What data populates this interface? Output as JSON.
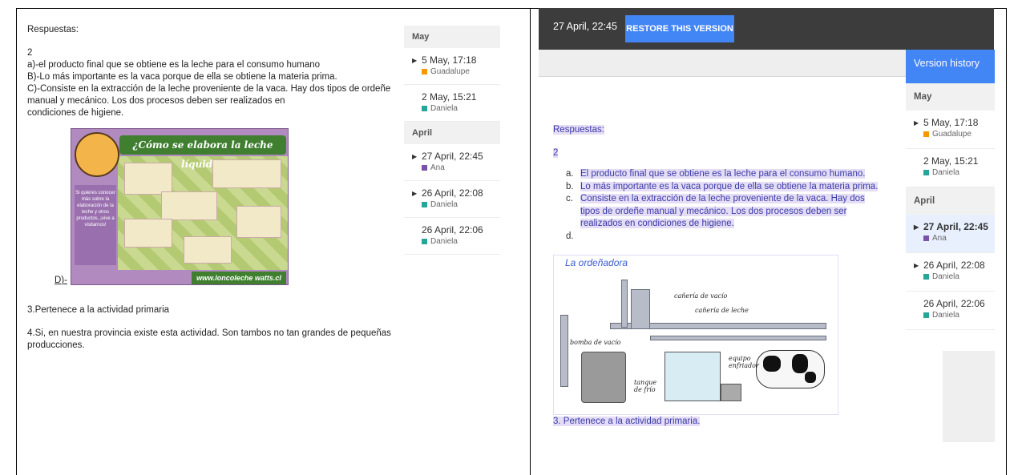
{
  "left": {
    "doc": {
      "heading": "Respuestas:",
      "number": "2",
      "line_a": "a)-el producto final que se obtiene es la leche para el consumo humano",
      "line_b": "B)-Lo más importante es la vaca porque de ella se obtiene la materia prima.",
      "line_c1": "C)-Consiste en la extracción  de la leche proveniente de la vaca. Hay dos tipos de ordeñe",
      "line_c2": "manual y mecánico. Los dos procesos deben ser realizados en",
      "line_c3": " condiciones de higiene.",
      "d_label": "D)-",
      "item3": "3.Pertenece a la actividad primaria",
      "item4": "4.Si, en nuestra provincia existe esta actividad. Son tambos no tan grandes de pequeñas producciones."
    },
    "infographic": {
      "banner": "¿Cómo se elabora la leche líquida?",
      "side_text": "Si quieres conocer más sobre la elaboración de la leche y otros productos, ¡vive a visitarnos!",
      "url": "www.loncoleche watts.cl"
    },
    "versions": {
      "sections": [
        {
          "label": "May",
          "items": [
            {
              "date": "5 May, 17:18",
              "user": "Guadalupe",
              "color": "#f29900",
              "expand": true
            },
            {
              "date": "2 May, 15:21",
              "user": "Daniela",
              "color": "#26a69a",
              "expand": false
            }
          ]
        },
        {
          "label": "April",
          "items": [
            {
              "date": "27 April, 22:45",
              "user": "Ana",
              "color": "#7b52ab",
              "expand": true
            },
            {
              "date": "26 April, 22:08",
              "user": "Daniela",
              "color": "#26a69a",
              "expand": true
            },
            {
              "date": "26 April, 22:06",
              "user": "Daniela",
              "color": "#26a69a",
              "expand": false
            }
          ]
        }
      ]
    }
  },
  "right": {
    "topbar": {
      "date": "27 April, 22:45",
      "restore": "RESTORE THIS VERSION"
    },
    "version_history_title": "Version history",
    "doc": {
      "heading": "Respuestas:",
      "number": "2",
      "items": [
        {
          "mark": "a.",
          "text": "El producto final que se obtiene es la leche para el consumo humano."
        },
        {
          "mark": "b.",
          "text": "Lo más importante es la vaca porque de ella se obtiene la materia prima."
        },
        {
          "mark": "c.",
          "text": "Consiste en la extracción  de la leche proveniente de la vaca. Hay dos tipos de ordeñe manual y mecánico. Los dos procesos deben ser realizados en  condiciones de higiene."
        },
        {
          "mark": "d.",
          "text": ""
        }
      ],
      "item3": "3. Pertenece a la actividad primaria."
    },
    "diagram": {
      "title": "La ordeñadora",
      "labels": {
        "vacuum_pipe": "cañería de vacío",
        "milk_pipe": "cañería de leche",
        "pump": "bomba de vacío",
        "tank": "tanque de frío",
        "cooler": "equipo enfriador"
      }
    },
    "versions": {
      "sections": [
        {
          "label": "May",
          "items": [
            {
              "date": "5 May, 17:18",
              "user": "Guadalupe",
              "color": "#f29900",
              "expand": true
            },
            {
              "date": "2 May, 15:21",
              "user": "Daniela",
              "color": "#26a69a",
              "expand": false
            }
          ]
        },
        {
          "label": "April",
          "items": [
            {
              "date": "27 April, 22:45",
              "user": "Ana",
              "color": "#7b52ab",
              "expand": true,
              "selected": true
            },
            {
              "date": "26 April, 22:08",
              "user": "Daniela",
              "color": "#26a69a",
              "expand": true
            },
            {
              "date": "26 April, 22:06",
              "user": "Daniela",
              "color": "#26a69a",
              "expand": false
            }
          ]
        }
      ]
    }
  }
}
